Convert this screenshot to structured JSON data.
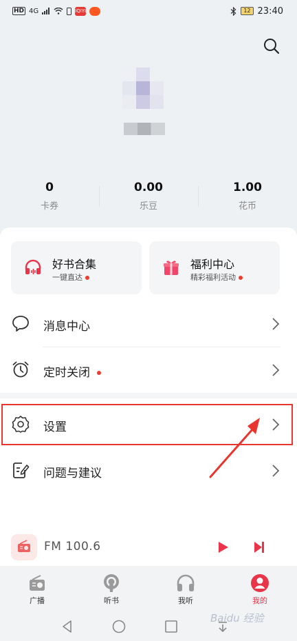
{
  "status_bar": {
    "left_label": "HD",
    "signal_label": "4G",
    "app_badge": "IQIYI",
    "time": "23:40",
    "battery": "12"
  },
  "header": {
    "search_icon": "search-icon"
  },
  "stats": [
    {
      "value": "0",
      "label": "卡券"
    },
    {
      "value": "0.00",
      "label": "乐豆"
    },
    {
      "value": "1.00",
      "label": "花币"
    }
  ],
  "cards": [
    {
      "title": "好书合集",
      "subtitle": "一键直达",
      "icon": "headphones-icon"
    },
    {
      "title": "福利中心",
      "subtitle": "精彩福利活动",
      "icon": "gift-icon"
    }
  ],
  "menu": [
    {
      "label": "消息中心",
      "icon": "chat-bubble-icon"
    },
    {
      "label": "定时关闭",
      "icon": "alarm-clock-icon"
    },
    {
      "label": "设置",
      "icon": "gear-icon"
    },
    {
      "label": "问题与建议",
      "icon": "feedback-edit-icon"
    }
  ],
  "player": {
    "station": "FM  100.6"
  },
  "tabs": [
    {
      "label": "广播",
      "icon": "radio-icon",
      "active": false
    },
    {
      "label": "听书",
      "icon": "podcast-icon",
      "active": false
    },
    {
      "label": "我听",
      "icon": "headphones-icon",
      "active": false
    },
    {
      "label": "我的",
      "icon": "user-icon",
      "active": true
    }
  ],
  "watermark": "Baidu 经验",
  "colors": {
    "accent": "#e8354a",
    "highlight": "#e8352e",
    "notification_dot": "#ef3b2f",
    "background": "#eef1f4"
  }
}
